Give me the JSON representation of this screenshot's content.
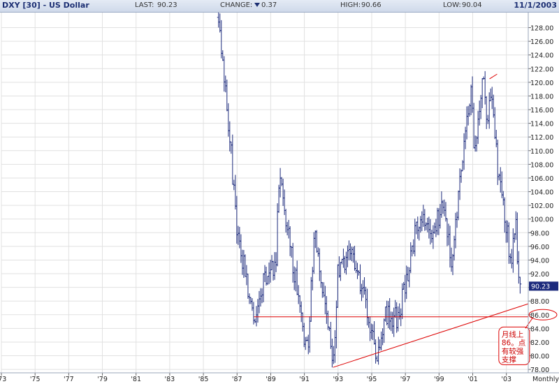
{
  "header": {
    "title": "DXY [30] - US Dollar",
    "last_label": "LAST:",
    "last_value": "90.23",
    "change_label": "CHANGE:",
    "change_value": "0.37",
    "high_label": "HIGH:",
    "high_value": "90.66",
    "low_label": "LOW:",
    "low_value": "90.04",
    "date": "11/1/2003"
  },
  "colors": {
    "bars": "#1c2a7c",
    "annotation": "#dd0000",
    "grid": "#e1e1e1",
    "last_box": "#1c2a7c"
  },
  "chart_data": {
    "type": "bar",
    "style": "ohlc",
    "frequency": "Monthly",
    "frequency_label": "Monthly",
    "xlim": [
      1973.0,
      2004.3
    ],
    "ylim": [
      77.5,
      130.2
    ],
    "x_ticks": [
      {
        "label": "'73",
        "x": 1973
      },
      {
        "label": "'75",
        "x": 1975
      },
      {
        "label": "'77",
        "x": 1977
      },
      {
        "label": "'79",
        "x": 1979
      },
      {
        "label": "'81",
        "x": 1981
      },
      {
        "label": "'83",
        "x": 1983
      },
      {
        "label": "'85",
        "x": 1985
      },
      {
        "label": "'87",
        "x": 1987
      },
      {
        "label": "'89",
        "x": 1989
      },
      {
        "label": "'91",
        "x": 1991
      },
      {
        "label": "'93",
        "x": 1993
      },
      {
        "label": "'95",
        "x": 1995
      },
      {
        "label": "'97",
        "x": 1997
      },
      {
        "label": "'99",
        "x": 1999
      },
      {
        "label": "'01",
        "x": 2001
      },
      {
        "label": "'03",
        "x": 2003
      }
    ],
    "y_ticks": [
      "78.00",
      "80.00",
      "82.00",
      "84.00",
      "86.00",
      "88.00",
      "90.00",
      "92.00",
      "94.00",
      "96.00",
      "98.00",
      "100.00",
      "102.00",
      "104.00",
      "106.00",
      "108.00",
      "110.00",
      "112.00",
      "114.00",
      "116.00",
      "118.00",
      "120.00",
      "122.00",
      "124.00",
      "126.00",
      "128.00"
    ],
    "grid": true,
    "last_price": {
      "value": 90.23,
      "label": "90.23"
    },
    "highlighted_level": {
      "value": 86.0,
      "label": "86.00"
    },
    "key_points": [
      {
        "x": 1985.9,
        "y": 129.5
      },
      {
        "x": 1986.6,
        "y": 111.0
      },
      {
        "x": 1987.0,
        "y": 98.0
      },
      {
        "x": 1988.0,
        "y": 85.7
      },
      {
        "x": 1988.6,
        "y": 91.5
      },
      {
        "x": 1989.3,
        "y": 93.0
      },
      {
        "x": 1989.5,
        "y": 106.8
      },
      {
        "x": 1990.3,
        "y": 94.0
      },
      {
        "x": 1990.9,
        "y": 84.0
      },
      {
        "x": 1991.2,
        "y": 81.0
      },
      {
        "x": 1991.6,
        "y": 97.8
      },
      {
        "x": 1992.4,
        "y": 85.0
      },
      {
        "x": 1992.7,
        "y": 78.3
      },
      {
        "x": 1993.0,
        "y": 93.0
      },
      {
        "x": 1993.9,
        "y": 95.0
      },
      {
        "x": 1994.6,
        "y": 88.0
      },
      {
        "x": 1995.3,
        "y": 80.0
      },
      {
        "x": 1995.8,
        "y": 86.0
      },
      {
        "x": 1996.5,
        "y": 85.5
      },
      {
        "x": 1997.0,
        "y": 90.0
      },
      {
        "x": 1997.5,
        "y": 97.0
      },
      {
        "x": 1998.1,
        "y": 101.0
      },
      {
        "x": 1998.6,
        "y": 97.0
      },
      {
        "x": 1999.2,
        "y": 102.5
      },
      {
        "x": 1999.8,
        "y": 93.0
      },
      {
        "x": 2000.3,
        "y": 108.0
      },
      {
        "x": 2000.9,
        "y": 118.0
      },
      {
        "x": 2001.1,
        "y": 110.0
      },
      {
        "x": 2001.6,
        "y": 121.0
      },
      {
        "x": 2001.9,
        "y": 113.0
      },
      {
        "x": 2002.1,
        "y": 120.5
      },
      {
        "x": 2002.5,
        "y": 106.0
      },
      {
        "x": 2002.8,
        "y": 103.0
      },
      {
        "x": 2003.1,
        "y": 97.0
      },
      {
        "x": 2003.3,
        "y": 93.0
      },
      {
        "x": 2003.55,
        "y": 99.5
      },
      {
        "x": 2003.7,
        "y": 93.0
      },
      {
        "x": 2003.83,
        "y": 90.2
      }
    ],
    "support_line": {
      "y": 85.7,
      "x_start": 1988.0,
      "x_end": 2004.3
    },
    "trend_line": {
      "x_start": 1992.7,
      "y_start": 78.3,
      "x_end": 2004.3,
      "y_end": 87.6
    },
    "peak_marker": {
      "x_start": 2002.0,
      "y_start": 120.5,
      "x_end": 2002.45,
      "y_end": 121.2
    },
    "annotation": {
      "lines": [
        "月线上",
        "86。点",
        "有较强",
        "支撑"
      ],
      "x": 2002.55,
      "y": 84.2
    }
  }
}
